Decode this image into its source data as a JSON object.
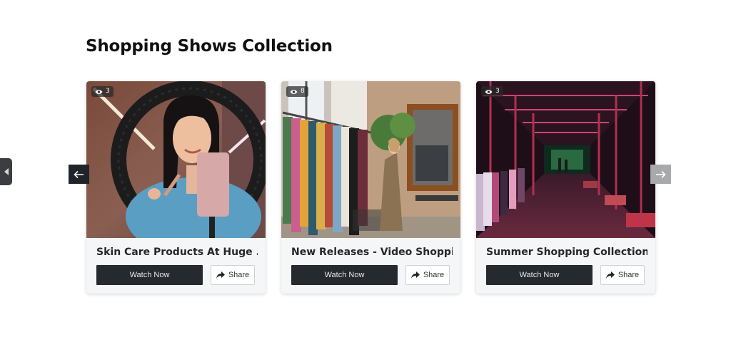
{
  "page": {
    "title": "Shopping Shows Collection"
  },
  "carousel": {
    "prev_icon": "arrow-left-icon",
    "next_icon": "arrow-right-icon",
    "side_tab_icon": "caret-left-icon",
    "cards": [
      {
        "title": "Skin Care Products At Huge ...",
        "views": "3",
        "watch_label": "Watch Now",
        "share_label": "Share",
        "image": "woman-with-ring-light-and-phone"
      },
      {
        "title": "New Releases - Video Shoppi...",
        "views": "8",
        "watch_label": "Watch Now",
        "share_label": "Share",
        "image": "woman-browsing-clothing-rack"
      },
      {
        "title": "Summer Shopping Collection...",
        "views": "3",
        "watch_label": "Watch Now",
        "share_label": "Share",
        "image": "neon-lit-clothing-store"
      }
    ]
  },
  "colors": {
    "button_dark": "#252930",
    "nav_prev_bg": "#1f232a",
    "nav_next_bg": "#a8a9ab",
    "card_bg": "#f5f6f8"
  }
}
